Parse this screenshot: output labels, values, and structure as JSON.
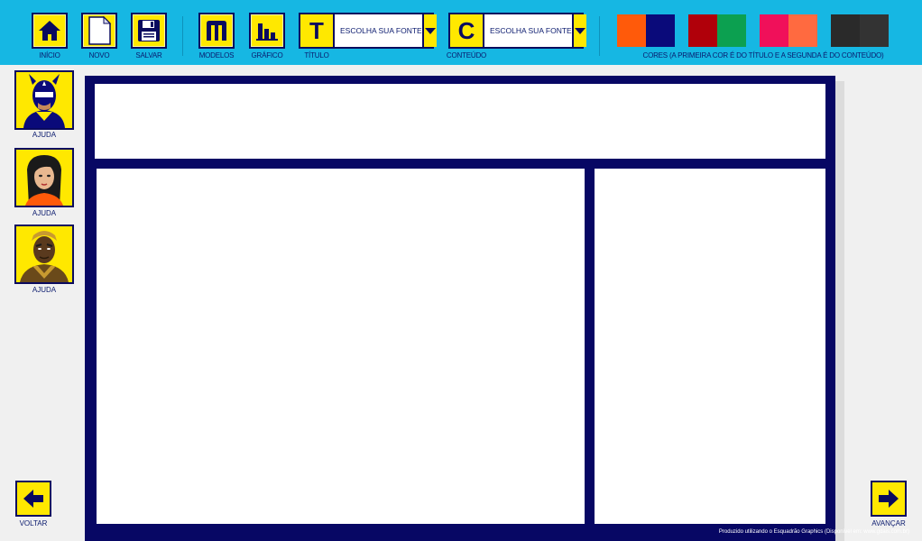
{
  "toolbar": {
    "home_label": "INÍCIO",
    "new_label": "NOVO",
    "save_label": "SALVAR",
    "models_label": "MODELOS",
    "chart_label": "GRÁFICO",
    "title_label": "TÍTULO",
    "title_letter": "T",
    "title_font_value": "ESCOLHA SUA FONTE",
    "content_label": "CONTEÚDO",
    "content_letter": "C",
    "content_font_value": "ESCOLHA SUA FONTE",
    "colors_label": "CORES (A PRIMEIRA COR É DO TÍTULO E A SEGUNDA É DO CONTEÚDO)",
    "color_pairs": [
      {
        "first": "#ff5a0a",
        "second": "#0a0a7a"
      },
      {
        "first": "#b0000a",
        "second": "#0ca050"
      },
      {
        "first": "#f0105a",
        "second": "#ff6a40"
      },
      {
        "first": "#2a2a2a",
        "second": "#333333"
      }
    ]
  },
  "sidebar": {
    "help_items": [
      {
        "label": "AJUDA",
        "icon": "hero-masked-avatar-icon"
      },
      {
        "label": "AJUDA",
        "icon": "heroine-avatar-icon"
      },
      {
        "label": "AJUDA",
        "icon": "warrior-avatar-icon"
      }
    ]
  },
  "nav": {
    "back_label": "VOLTAR",
    "forward_label": "AVANÇAR"
  },
  "footer": {
    "credit": "Produzido utilizando o Esquadrão Graphics (Disponível em: www.gdais.com.br)"
  },
  "colors": {
    "topbar": "#16b7e3",
    "button": "#ffe800",
    "board": "#070764"
  }
}
